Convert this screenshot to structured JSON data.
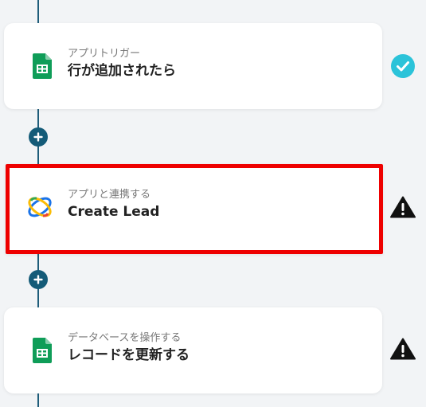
{
  "flow": {
    "steps": [
      {
        "subtitle": "アプリトリガー",
        "title": "行が追加されたら",
        "icon": "google-sheets-icon",
        "status": "success-check-icon"
      },
      {
        "subtitle": "アプリと連携する",
        "title": "Create Lead",
        "icon": "crm-app-logo-icon",
        "status": "warning-icon",
        "selected": true
      },
      {
        "subtitle": "データベースを操作する",
        "title": "レコードを更新する",
        "icon": "google-sheets-icon",
        "status": "warning-icon"
      }
    ],
    "add_step_icon": "plus-icon"
  },
  "colors": {
    "background": "#f2f4f6",
    "connector": "#145b78",
    "highlight_border": "#ee0000",
    "success": "#2bc3d9",
    "warning": "#111111",
    "sheets_green": "#0f9d58"
  }
}
